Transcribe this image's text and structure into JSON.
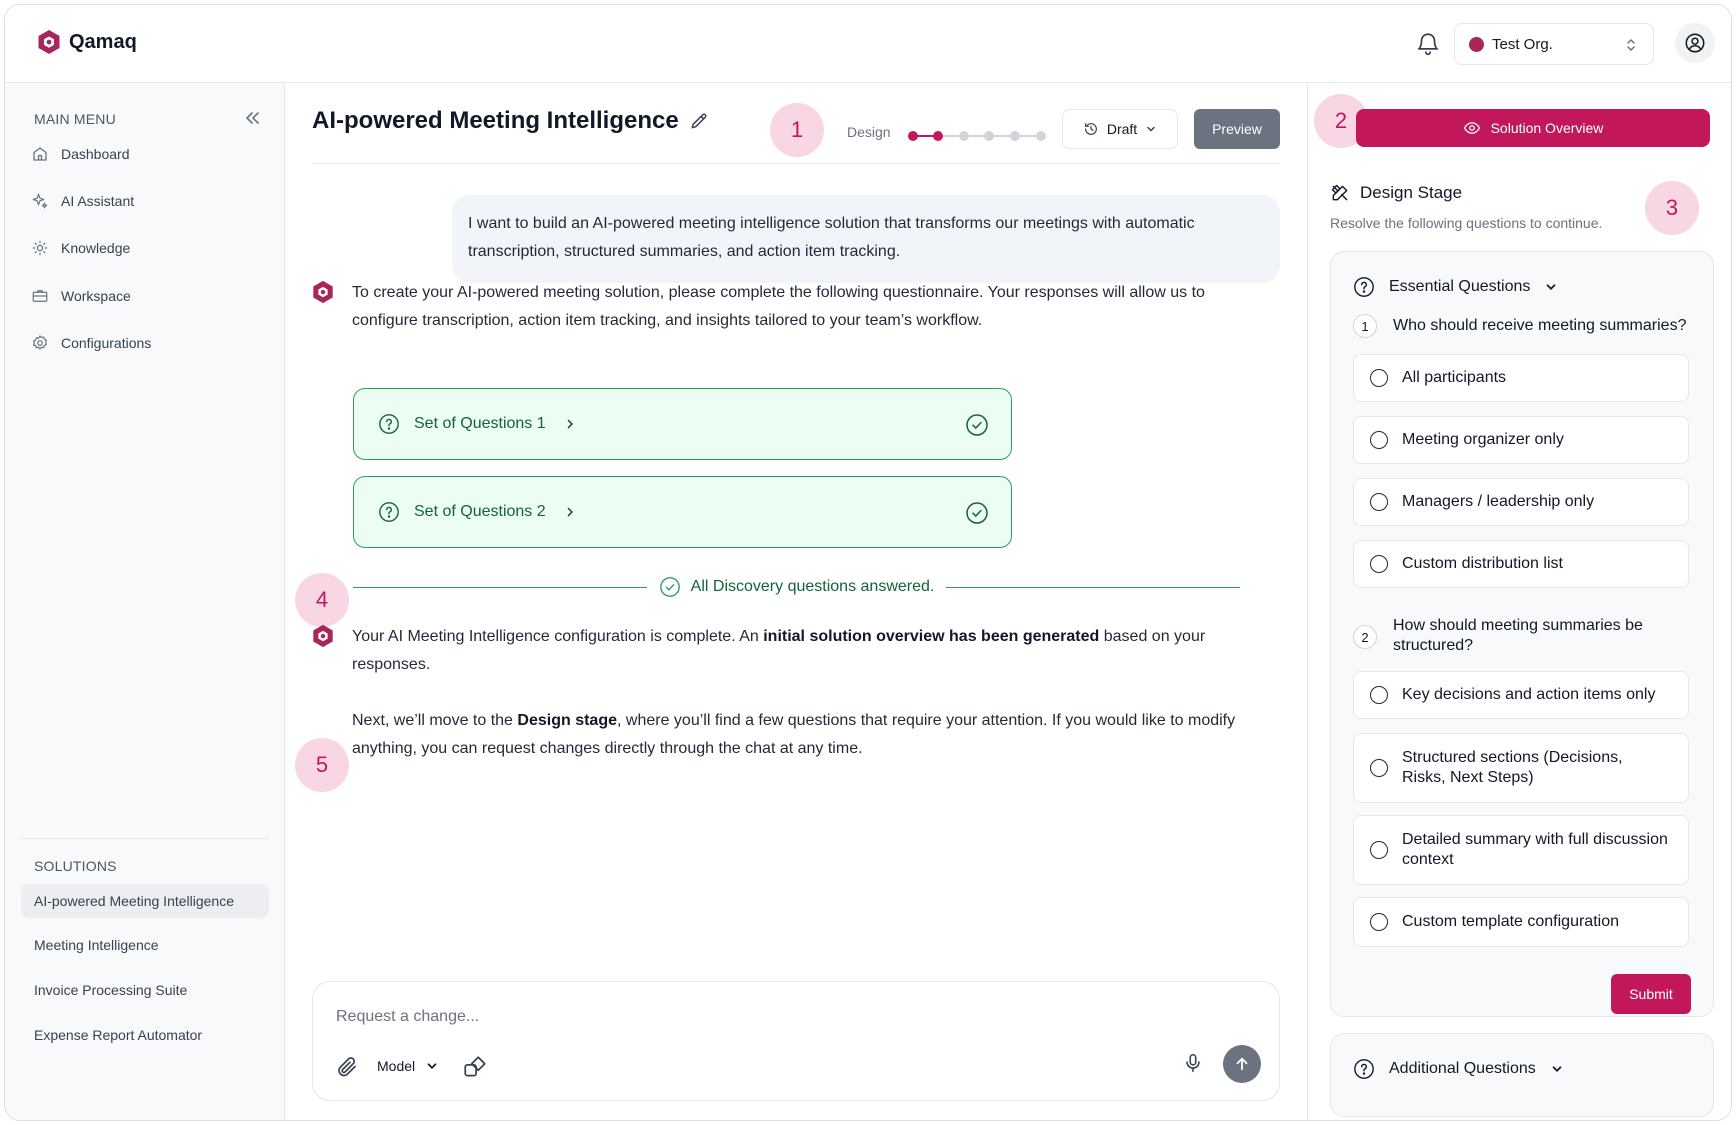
{
  "app": {
    "name": "Qamaq"
  },
  "header": {
    "org_name": "Test Org."
  },
  "sidebar": {
    "main_menu_label": "MAIN MENU",
    "items": [
      {
        "label": "Dashboard",
        "icon": "home-icon"
      },
      {
        "label": "AI Assistant",
        "icon": "sparkle-icon"
      },
      {
        "label": "Knowledge",
        "icon": "lightbulb-icon"
      },
      {
        "label": "Workspace",
        "icon": "briefcase-icon"
      },
      {
        "label": "Configurations",
        "icon": "gear-icon"
      }
    ],
    "solutions_label": "SOLUTIONS",
    "solutions": [
      {
        "label": "AI-powered Meeting Intelligence",
        "active": true
      },
      {
        "label": "Meeting Intelligence",
        "active": false
      },
      {
        "label": "Invoice Processing Suite",
        "active": false
      },
      {
        "label": "Expense Report Automator",
        "active": false
      }
    ]
  },
  "main": {
    "title": "AI-powered Meeting Intelligence",
    "stage_label": "Design",
    "stepper": {
      "total_steps": 6,
      "completed_steps": 2
    },
    "status_label": "Draft",
    "preview_label": "Preview",
    "annotations": [
      "1",
      "2",
      "3",
      "4",
      "5"
    ],
    "user_message": "I want to build an AI-powered meeting intelligence solution that transforms our meetings with automatic transcription, structured summaries, and action item tracking.",
    "bot_message_1": "To create your AI-powered meeting solution, please complete the following questionnaire. Your responses will allow us to configure transcription, action item tracking, and insights tailored to your team’s workflow.",
    "question_sets": [
      "Set of Questions 1",
      "Set of Questions 2"
    ],
    "answered_label": "All Discovery questions answered.",
    "bot_message_2": {
      "part1": "Your AI Meeting Intelligence configuration is complete. An ",
      "bold": "initial solution overview has been generated",
      "part2": " based on your responses."
    },
    "bot_message_3": {
      "part1": "Next, we’ll move to the ",
      "bold": "Design stage",
      "part2": ", where you’ll find a few questions that require your attention. If you would like to modify anything, you can request changes directly through the chat at any time."
    },
    "chat": {
      "placeholder": "Request a change...",
      "model_label": "Model"
    }
  },
  "right_panel": {
    "overview_label": "Solution Overview",
    "stage_title": "Design Stage",
    "stage_subtitle": "Resolve the following questions to continue.",
    "essential_label": "Essential Questions",
    "questions": [
      {
        "number": "1",
        "text": "Who should receive meeting summaries?",
        "options": [
          "All participants",
          "Meeting organizer only",
          "Managers / leadership only",
          "Custom distribution list"
        ]
      },
      {
        "number": "2",
        "text": "How should meeting summaries be structured?",
        "options": [
          "Key decisions and action items only",
          "Structured sections (Decisions, Risks, Next Steps)",
          "Detailed summary with full discussion context",
          "Custom template configuration"
        ]
      }
    ],
    "submit_label": "Submit",
    "additional_label": "Additional Questions"
  },
  "colors": {
    "brand": "#c2185b",
    "badge_bg": "#f9d6e4",
    "success": "#2e9e5f",
    "success_bg": "#ecfdf3",
    "neutral_button": "#6b7280"
  }
}
